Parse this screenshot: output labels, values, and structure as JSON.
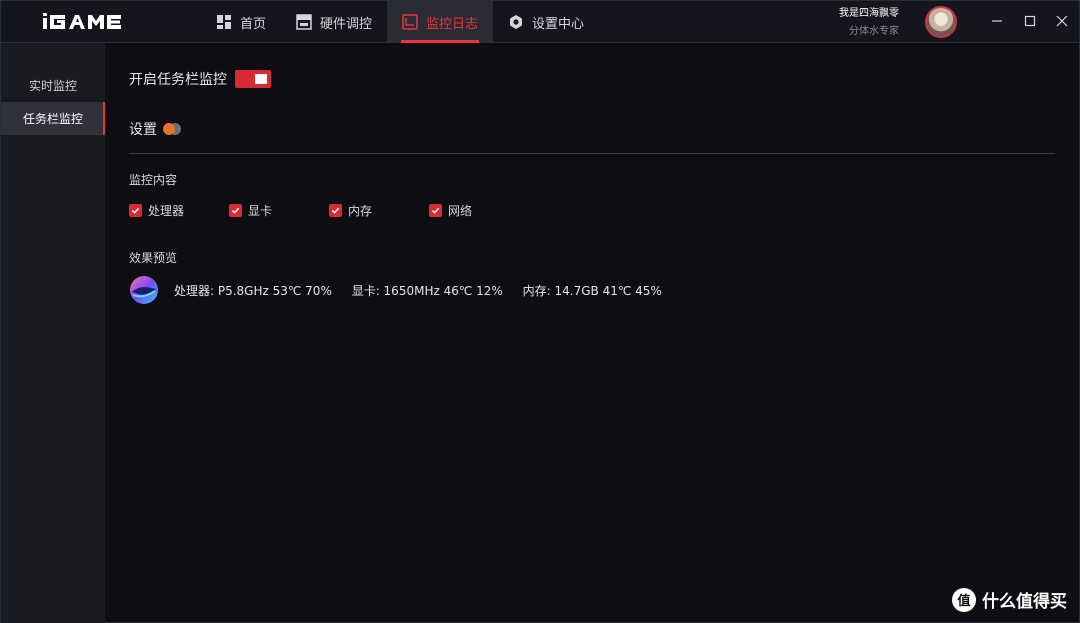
{
  "app": {
    "brand": "iGAME",
    "accent": "#e8343c"
  },
  "nav": {
    "items": [
      {
        "label": "首页",
        "icon": "home-grid-icon"
      },
      {
        "label": "硬件调控",
        "icon": "hardware-control-icon"
      },
      {
        "label": "监控日志",
        "icon": "monitor-log-icon",
        "active": true
      },
      {
        "label": "设置中心",
        "icon": "settings-gear-icon"
      }
    ]
  },
  "user": {
    "name": "我是四海飘零",
    "role": "分体水专家"
  },
  "sidebar": {
    "items": [
      {
        "label": "实时监控"
      },
      {
        "label": "任务栏监控",
        "active": true
      }
    ]
  },
  "main": {
    "enable_label": "开启任务栏监控",
    "enable_on": true,
    "settings_label": "设置",
    "content_title": "监控内容",
    "checks": [
      {
        "label": "处理器",
        "checked": true
      },
      {
        "label": "显卡",
        "checked": true
      },
      {
        "label": "内存",
        "checked": true
      },
      {
        "label": "网络",
        "checked": true
      }
    ],
    "preview_title": "效果预览",
    "preview": {
      "cpu": "处理器: P5.8GHz 53℃ 70%",
      "gpu": "显卡: 1650MHz 46℃ 12%",
      "mem": "内存: 14.7GB 41℃ 45%"
    }
  },
  "watermark": {
    "icon_text": "值",
    "text": "什么值得买"
  }
}
